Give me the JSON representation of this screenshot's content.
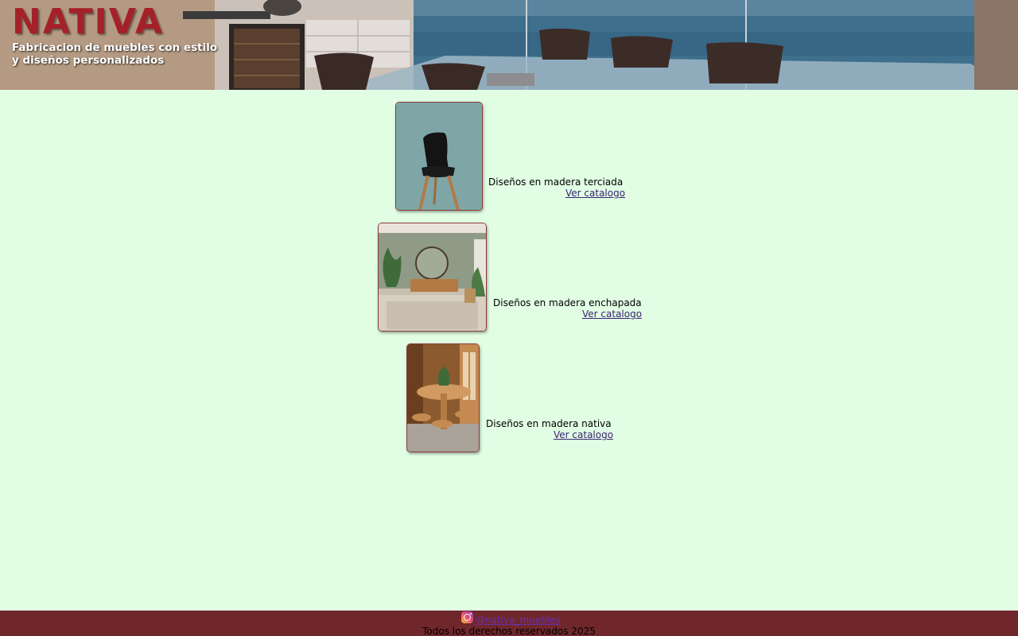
{
  "header": {
    "brand_name": "NATIVA",
    "tagline": "Fabricacion de muebles con estilo\ny diseños personalizados"
  },
  "catalog": {
    "items": [
      {
        "image_icon": "chair-image",
        "title": "Diseños en madera terciada",
        "link_label": "Ver catalogo"
      },
      {
        "image_icon": "living-room-image",
        "title": "Diseños en madera enchapada",
        "link_label": "Ver catalogo"
      },
      {
        "image_icon": "dining-table-image",
        "title": "Diseños en madera nativa",
        "link_label": "Ver catalogo"
      }
    ]
  },
  "footer": {
    "instagram_icon": "instagram-icon",
    "instagram_handle": "@nativa_muebles",
    "copyright": "Todos los derechos reservados 2025"
  },
  "colors": {
    "page_background": "#e1fee4",
    "brand_red": "#a52129",
    "footer_background": "#70272b",
    "link": "#3a2370"
  }
}
